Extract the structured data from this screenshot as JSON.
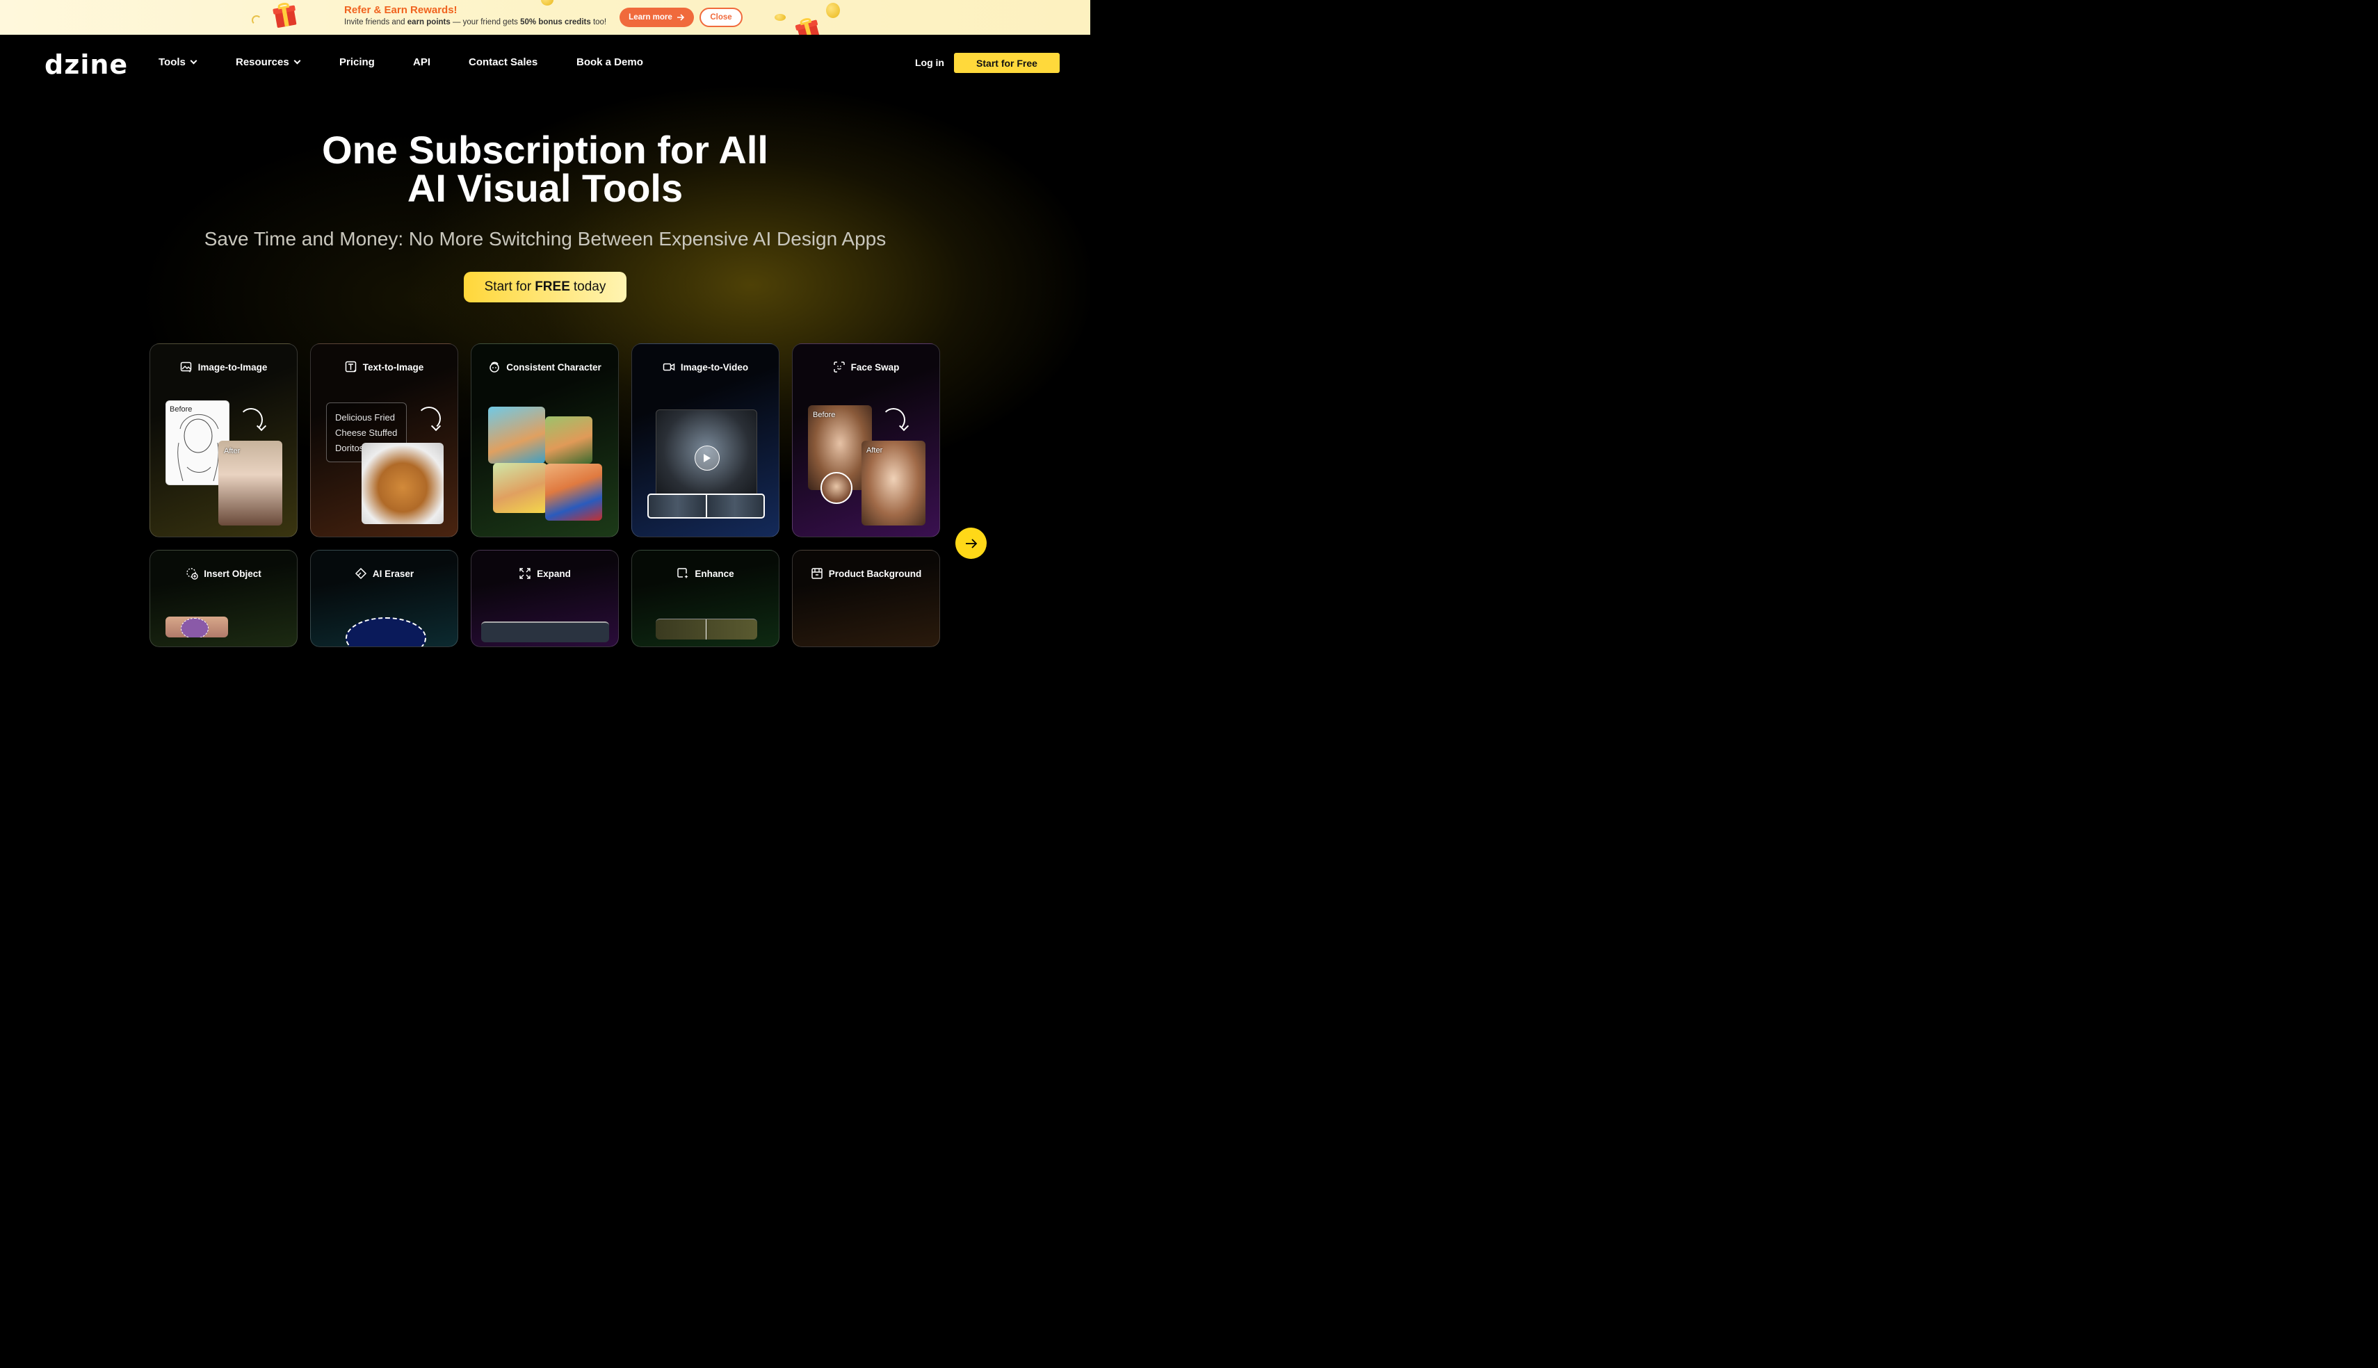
{
  "promo": {
    "title": "Refer & Earn Rewards!",
    "sub_prefix": "Invite friends and ",
    "sub_bold1": "earn points",
    "sub_middle": " — your friend gets ",
    "sub_bold2": "50% bonus credits",
    "sub_suffix": " too!",
    "learn_more": "Learn more",
    "close": "Close"
  },
  "nav": {
    "logo": "dzine",
    "items": [
      "Tools",
      "Resources",
      "Pricing",
      "API",
      "Contact Sales",
      "Book a Demo"
    ],
    "login": "Log in",
    "start": "Start for Free"
  },
  "hero": {
    "title_line1": "One Subscription for All",
    "title_line2": "AI Visual Tools",
    "subtitle": "Save Time and Money: No More Switching Between Expensive AI Design Apps",
    "cta_prefix": "Start for",
    "cta_bold": "FREE",
    "cta_suffix": "today"
  },
  "cards": [
    {
      "title": "Image-to-Image",
      "icon": "image-sparkle-icon",
      "before": "Before",
      "after": "After"
    },
    {
      "title": "Text-to-Image",
      "icon": "text-sparkle-icon",
      "prompt": "Delicious Fried Cheese Stuffed Doritos"
    },
    {
      "title": "Consistent Character",
      "icon": "character-icon"
    },
    {
      "title": "Image-to-Video",
      "icon": "video-camera-icon"
    },
    {
      "title": "Face Swap",
      "icon": "face-swap-icon",
      "before": "Before",
      "after": "After"
    },
    {
      "title": "Insert Object",
      "icon": "insert-object-icon"
    },
    {
      "title": "AI Eraser",
      "icon": "eraser-icon"
    },
    {
      "title": "Expand",
      "icon": "expand-icon"
    },
    {
      "title": "Enhance",
      "icon": "enhance-icon"
    },
    {
      "title": "Product Background",
      "icon": "storefront-icon"
    }
  ],
  "colors": {
    "accent": "#ffd93b",
    "promo_orange": "#f06a3c"
  }
}
